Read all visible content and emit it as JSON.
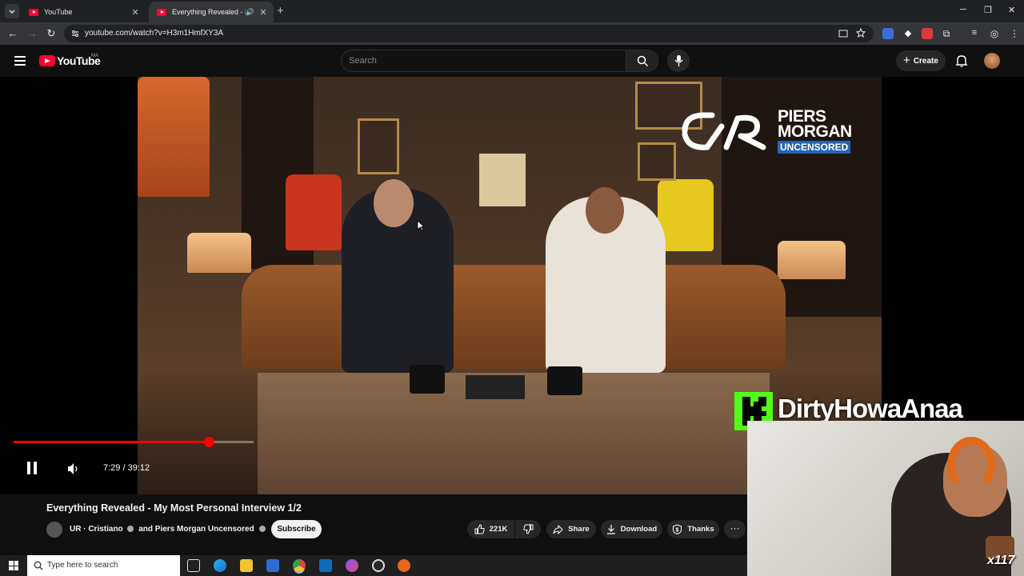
{
  "browser": {
    "tabs": [
      {
        "title": "YouTube",
        "active": false
      },
      {
        "title": "Everything Revealed - My M",
        "active": true
      }
    ],
    "url": "youtube.com/watch?v=H3m1HmfXY3A"
  },
  "youtube": {
    "logo_text": "YouTube",
    "country_code": "MA",
    "search_placeholder": "Search",
    "create_label": "Create"
  },
  "video": {
    "time": "7:29 / 39:12",
    "progress_fraction": 0.191,
    "buffered_fraction": 0.245,
    "overlay_brand_lines": [
      "PIERS",
      "MORGAN",
      "UNCENSORED"
    ],
    "streamer_name": "DirtyHowaAnaa",
    "badge_text": "x117"
  },
  "info": {
    "title": "Everything Revealed - My Most Personal Interview 1/2",
    "channel_a": "UR · Cristiano",
    "channel_join": "and",
    "channel_b": "Piers Morgan Uncensored",
    "subscribe_label": "Subscribe",
    "likes": "221K",
    "share_label": "Share",
    "download_label": "Download",
    "thanks_label": "Thanks",
    "more_label": "···"
  },
  "taskbar": {
    "search_placeholder": "Type here to search"
  },
  "colors": {
    "youtube_red": "#ff0033",
    "progress_red": "#ff0000",
    "kick_green": "#53fc18",
    "pm_blue": "#2563b8"
  }
}
